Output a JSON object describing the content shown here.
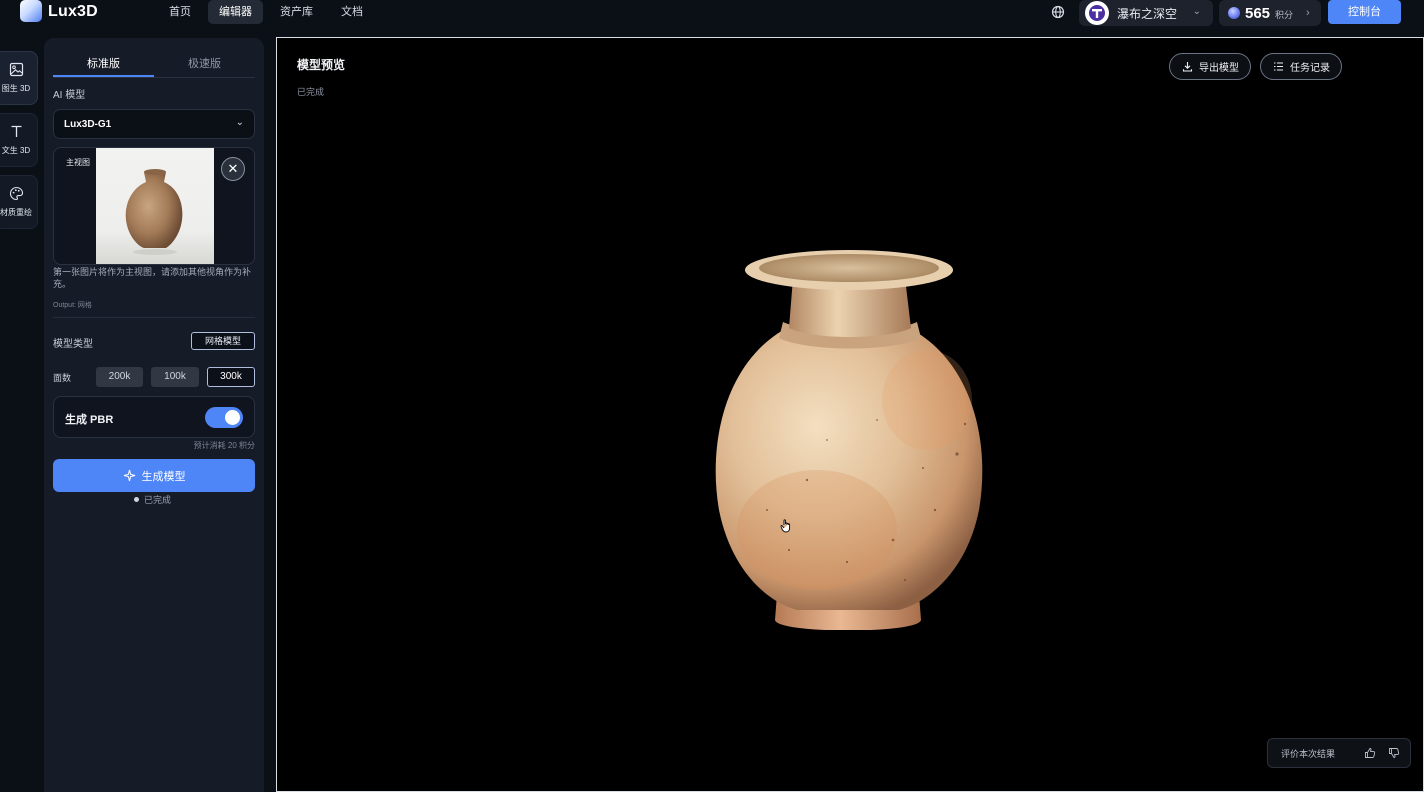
{
  "brand": {
    "name": "Lux3D"
  },
  "nav": [
    {
      "label": "首页"
    },
    {
      "label": "编辑器",
      "active": true
    },
    {
      "label": "资产库"
    },
    {
      "label": "文档"
    }
  ],
  "user": {
    "name": "瀑布之深空"
  },
  "credits": {
    "amount": "565",
    "unit": "积分"
  },
  "console_label": "控制台",
  "rail": [
    {
      "label": "图生 3D",
      "icon": "image-icon",
      "active": true
    },
    {
      "label": "文生 3D",
      "icon": "text-icon"
    },
    {
      "label": "材质重绘",
      "icon": "palette-icon"
    }
  ],
  "panel": {
    "tabs": [
      {
        "label": "标准版",
        "active": true
      },
      {
        "label": "极速版"
      }
    ],
    "ai_model_label": "AI 模型",
    "ai_model_value": "Lux3D-G1",
    "main_view_tag": "主视图",
    "hint": "第一张图片将作为主视图，请添加其他视角作为补充。",
    "output_note": "Output: 网格",
    "model_type_label": "模型类型",
    "model_type_value": "网格模型",
    "faces_label": "面数",
    "faces_options": [
      "200k",
      "100k",
      "300k"
    ],
    "faces_selected": "300k",
    "pbr_label": "生成 PBR",
    "pbr_enabled": true,
    "cost_note": "预计消耗 20 积分",
    "generate_label": "生成模型",
    "status": "已完成"
  },
  "viewer": {
    "title": "模型预览",
    "status": "已完成",
    "export_label": "导出模型",
    "history_label": "任务记录",
    "rate_label": "评价本次结果"
  },
  "colors": {
    "accent": "#4f86f7",
    "background": "#0b0f16",
    "panel": "#151b27",
    "viewer": "#000000"
  }
}
